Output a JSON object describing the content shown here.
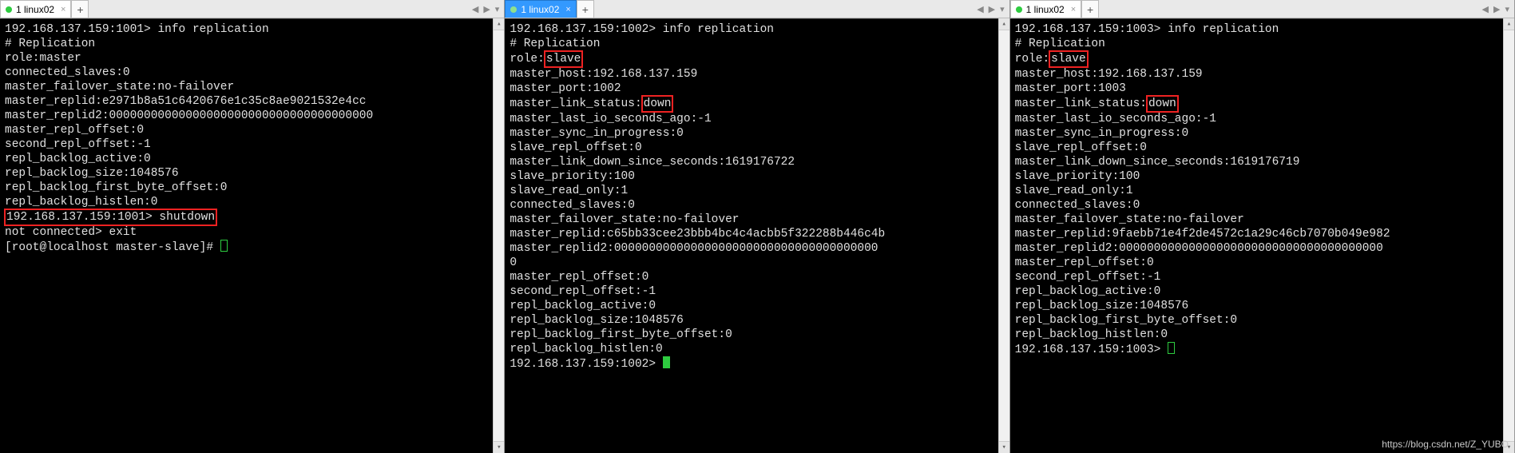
{
  "watermark": "https://blog.csdn.net/Z_YUBO",
  "panes": [
    {
      "tab_label": "1 linux02",
      "tab_active_blue": false,
      "prompt1": "192.168.137.159:1001> ",
      "cmd1": "info replication",
      "lines_a": [
        "# Replication",
        "role:master",
        "connected_slaves:0",
        "master_failover_state:no-failover",
        "master_replid:e2971b8a51c6420676e1c35c8ae9021532e4cc",
        "master_replid2:00000000000000000000000000000000000000",
        "master_repl_offset:0",
        "second_repl_offset:-1",
        "repl_backlog_active:0",
        "repl_backlog_size:1048576",
        "repl_backlog_first_byte_offset:0",
        "repl_backlog_histlen:0"
      ],
      "prompt2": "192.168.137.159:1001> shutdown",
      "lines_b": [
        "not connected> exit"
      ],
      "final_prompt": "[root@localhost master-slave]# ",
      "role_val": "",
      "link_status_val": ""
    },
    {
      "tab_label": "1 linux02",
      "tab_active_blue": true,
      "prompt1": "192.168.137.159:1002> ",
      "cmd1": "info replication",
      "lines_a": [
        "# Replication"
      ],
      "role_label": "role:",
      "role_val": "slave",
      "lines_b": [
        "master_host:192.168.137.159",
        "master_port:1002"
      ],
      "link_label": "master_link_status:",
      "link_status_val": "down",
      "lines_c": [
        "master_last_io_seconds_ago:-1",
        "master_sync_in_progress:0",
        "slave_repl_offset:0",
        "master_link_down_since_seconds:1619176722",
        "slave_priority:100",
        "slave_read_only:1",
        "connected_slaves:0",
        "master_failover_state:no-failover",
        "master_replid:c65bb33cee23bbb4bc4c4acbb5f322288b446c4b",
        "master_replid2:00000000000000000000000000000000000000",
        "0",
        "master_repl_offset:0",
        "second_repl_offset:-1",
        "repl_backlog_active:0",
        "repl_backlog_size:1048576",
        "repl_backlog_first_byte_offset:0",
        "repl_backlog_histlen:0"
      ],
      "final_prompt": "192.168.137.159:1002> "
    },
    {
      "tab_label": "1 linux02",
      "tab_active_blue": false,
      "prompt1": "192.168.137.159:1003> ",
      "cmd1": "info replication",
      "lines_a": [
        "# Replication"
      ],
      "role_label": "role:",
      "role_val": "slave",
      "lines_b": [
        "master_host:192.168.137.159",
        "master_port:1003"
      ],
      "link_label": "master_link_status:",
      "link_status_val": "down",
      "lines_c": [
        "master_last_io_seconds_ago:-1",
        "master_sync_in_progress:0",
        "slave_repl_offset:0",
        "master_link_down_since_seconds:1619176719",
        "slave_priority:100",
        "slave_read_only:1",
        "connected_slaves:0",
        "master_failover_state:no-failover",
        "master_replid:9faebb71e4f2de4572c1a29c46cb7070b049e982",
        "master_replid2:00000000000000000000000000000000000000",
        "master_repl_offset:0",
        "second_repl_offset:-1",
        "repl_backlog_active:0",
        "repl_backlog_size:1048576",
        "repl_backlog_first_byte_offset:0",
        "repl_backlog_histlen:0"
      ],
      "final_prompt": "192.168.137.159:1003> "
    }
  ]
}
